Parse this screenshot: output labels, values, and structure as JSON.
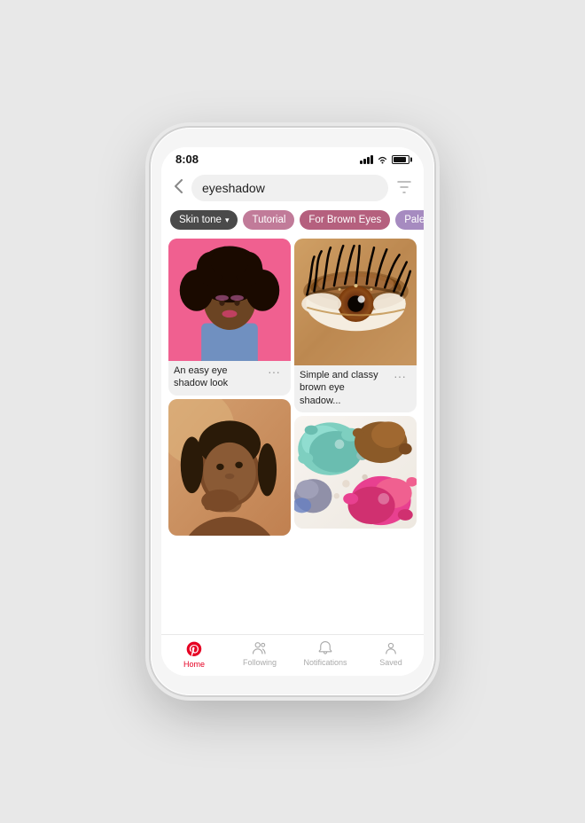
{
  "phone": {
    "status_bar": {
      "time": "8:08"
    },
    "search": {
      "query": "eyeshadow",
      "placeholder": "eyeshadow"
    },
    "filter_chips": [
      {
        "id": "skin-tone",
        "label": "Skin tone",
        "has_chevron": true,
        "style": "dark"
      },
      {
        "id": "tutorial",
        "label": "Tutorial",
        "has_chevron": false,
        "style": "pink"
      },
      {
        "id": "for-brown-eyes",
        "label": "For Brown Eyes",
        "has_chevron": false,
        "style": "active"
      },
      {
        "id": "palette",
        "label": "Pale",
        "has_chevron": false,
        "style": "purple"
      }
    ],
    "pins": {
      "left_column": [
        {
          "id": "pin-1",
          "caption": "An easy eye shadow look",
          "has_more": false,
          "more_position": "below"
        },
        {
          "id": "pin-3",
          "caption": "",
          "has_more": false,
          "more_position": "none"
        }
      ],
      "right_column": [
        {
          "id": "pin-2",
          "caption": "Simple and classy brown eye shadow...",
          "has_more": true,
          "more_position": "below"
        },
        {
          "id": "pin-4",
          "caption": "",
          "has_more": false,
          "more_position": "none"
        }
      ]
    },
    "bottom_nav": [
      {
        "id": "home",
        "label": "Home",
        "active": true
      },
      {
        "id": "following",
        "label": "Following",
        "active": false
      },
      {
        "id": "notifications",
        "label": "Notifications",
        "active": false
      },
      {
        "id": "saved",
        "label": "Saved",
        "active": false
      }
    ]
  }
}
